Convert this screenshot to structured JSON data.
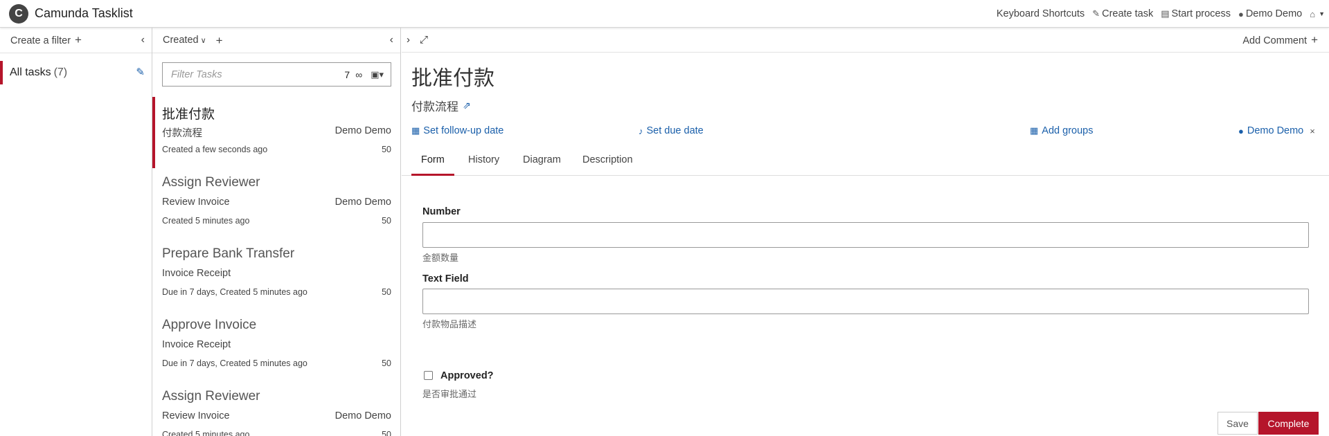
{
  "header": {
    "app_title": "Camunda Tasklist",
    "logo_letter": "C",
    "keyboard_shortcuts": "Keyboard Shortcuts",
    "create_task": "Create task",
    "start_process": "Start process",
    "user": "Demo Demo"
  },
  "filters": {
    "create_filter": "Create a filter",
    "items": [
      {
        "name": "All tasks",
        "count": "(7)"
      }
    ]
  },
  "task_list": {
    "sort_label": "Created",
    "search_placeholder": "Filter Tasks",
    "search_count": "7",
    "tasks": [
      {
        "title": "批准付款",
        "process": "付款流程",
        "assignee": "Demo Demo",
        "meta": "Created a few seconds ago",
        "priority": "50"
      },
      {
        "title": "Assign Reviewer",
        "process": "Review Invoice",
        "assignee": "Demo Demo",
        "meta": "Created 5 minutes ago",
        "priority": "50"
      },
      {
        "title": "Prepare Bank Transfer",
        "process": "Invoice Receipt",
        "assignee": "",
        "meta": "Due in 7 days, Created 5 minutes ago",
        "priority": "50"
      },
      {
        "title": "Approve Invoice",
        "process": "Invoice Receipt",
        "assignee": "",
        "meta": "Due in 7 days, Created 5 minutes ago",
        "priority": "50"
      },
      {
        "title": "Assign Reviewer",
        "process": "Review Invoice",
        "assignee": "Demo Demo",
        "meta": "Created 5 minutes ago",
        "priority": "50"
      }
    ]
  },
  "detail": {
    "add_comment": "Add Comment",
    "task_name": "批准付款",
    "process_name": "付款流程",
    "follow_up": "Set follow-up date",
    "due_date": "Set due date",
    "add_groups": "Add groups",
    "assignee": "Demo Demo",
    "tabs": [
      "Form",
      "History",
      "Diagram",
      "Description"
    ],
    "form": {
      "number_label": "Number",
      "number_value": "",
      "number_help": "金额数量",
      "text_label": "Text Field",
      "text_value": "",
      "text_help": "付款物品描述",
      "approved_label": "Approved?",
      "approved_help": "是否审批通过",
      "save_label": "Save",
      "complete_label": "Complete"
    }
  },
  "colors": {
    "accent": "#b5152b",
    "link": "#1a5faa"
  }
}
